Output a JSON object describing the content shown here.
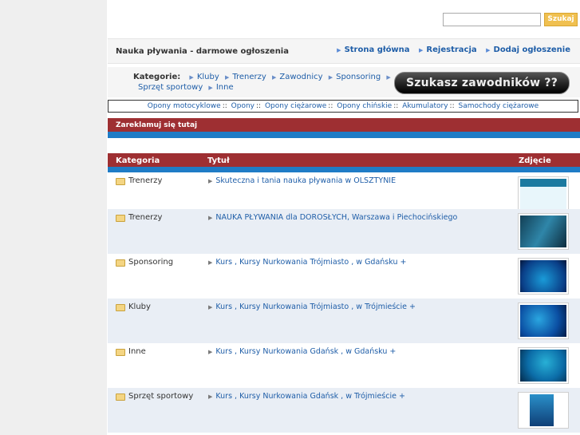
{
  "search": {
    "button_label": "Szukaj",
    "placeholder": ""
  },
  "header": {
    "site_title": "Nauka pływania - darmowe ogłoszenia",
    "nav": [
      "Strona główna",
      "Rejestracja",
      "Dodaj ogłoszenie"
    ]
  },
  "categories": {
    "label": "Kategorie:",
    "items_line1": [
      "Kluby",
      "Trenerzy",
      "Zawodnicy",
      "Sponsoring"
    ],
    "items_line2": [
      "Sprzęt sportowy",
      "Inne"
    ]
  },
  "banner": {
    "text": "Szukasz zawodników ??"
  },
  "links": [
    "Opony motocyklowe",
    "Opony",
    "Opony ciężarowe",
    "Opony chińskie",
    "Akumulatory",
    "Samochody ciężarowe"
  ],
  "links_separator": "::",
  "ad": {
    "text": "Zareklamuj się tutaj"
  },
  "table": {
    "headers": [
      "Kategoria",
      "Tytuł",
      "Zdjęcie"
    ],
    "rows": [
      {
        "category": "Trenerzy",
        "title": "Skuteczna i tania nauka pływania w OLSZTYNIE"
      },
      {
        "category": "Trenerzy",
        "title": "NAUKA PŁYWANIA dla DOROSŁYCH, Warszawa i Piechocińskiego"
      },
      {
        "category": "Sponsoring",
        "title": "Kurs , Kursy Nurkowania Trójmiasto , w Gdańsku +"
      },
      {
        "category": "Kluby",
        "title": "Kurs , Kursy Nurkowania Trójmiasto , w Trójmieście +"
      },
      {
        "category": "Inne",
        "title": "Kurs , Kursy Nurkowania Gdańsk , w Gdańsku +"
      },
      {
        "category": "Sprzęt sportowy",
        "title": "Kurs , Kursy Nurkowania Gdańsk , w Trójmieście +"
      }
    ]
  },
  "colors": {
    "header_red": "#9e2f32",
    "accent_blue": "#1f7cc6",
    "link_blue": "#1f5ea8",
    "search_button": "#f0c050"
  },
  "icons": {
    "folder": "folder-icon",
    "nav_arrow": "triangle-right-icon"
  }
}
